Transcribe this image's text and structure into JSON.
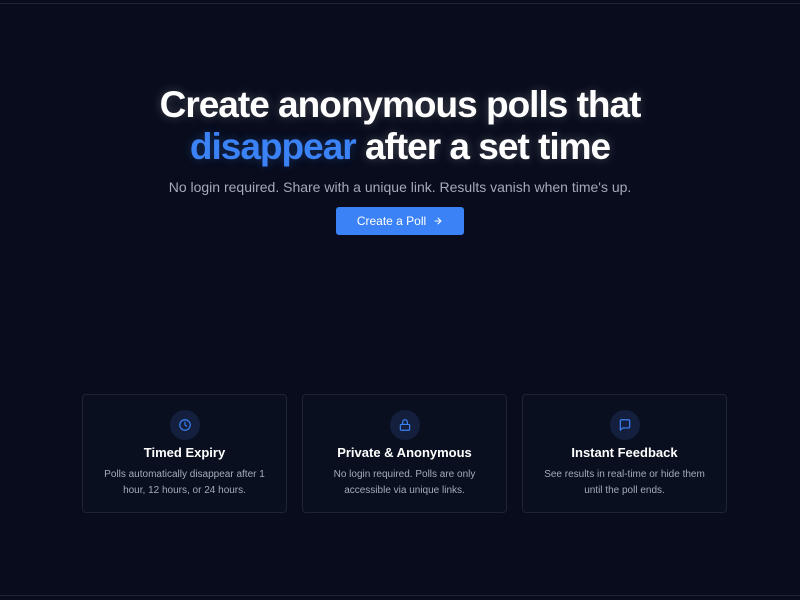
{
  "hero": {
    "title_line1": "Create anonymous polls that",
    "title_accent": "disappear",
    "title_line2_rest": " after a set time",
    "subtitle": "No login required. Share with a unique link. Results vanish when time's up.",
    "cta_label": "Create a Poll",
    "cta_icon": "arrow-right-icon"
  },
  "features": [
    {
      "icon": "clock-icon",
      "title": "Timed Expiry",
      "description": "Polls automatically disappear after 1 hour, 12 hours, or 24 hours."
    },
    {
      "icon": "lock-icon",
      "title": "Private & Anonymous",
      "description": "No login required. Polls are only accessible via unique links."
    },
    {
      "icon": "message-square-icon",
      "title": "Instant Feedback",
      "description": "See results in real-time or hide them until the poll ends."
    }
  ],
  "colors": {
    "background": "#080c1c",
    "accent": "#3b82f6",
    "muted_text": "#a3aab8",
    "card_border": "#1d2435"
  }
}
